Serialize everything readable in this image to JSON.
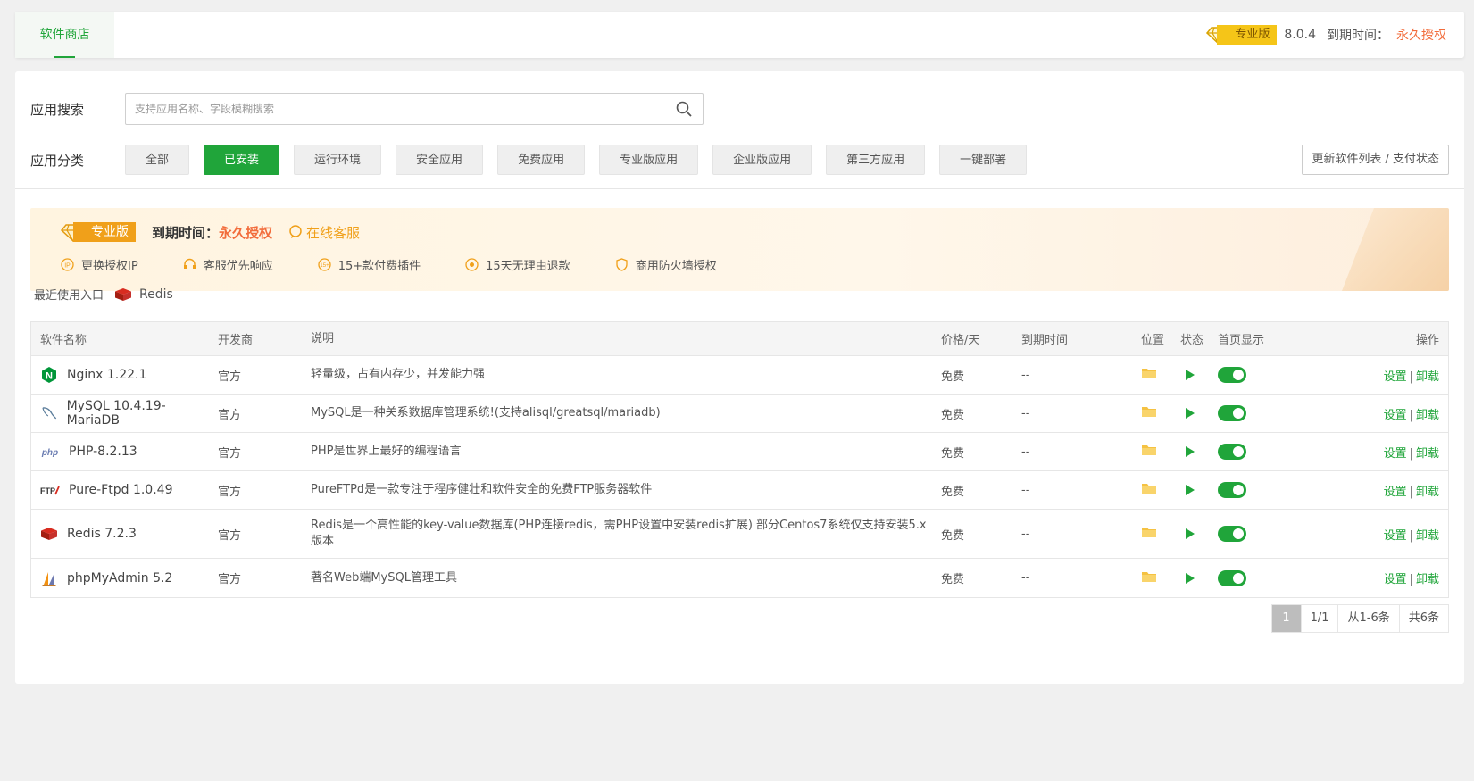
{
  "header": {
    "tab_store": "软件商店",
    "pro_label": "专业版",
    "version": "8.0.4",
    "expire_label": "到期时间：",
    "expire_value": "永久授权"
  },
  "search": {
    "label": "应用搜索",
    "placeholder": "支持应用名称、字段模糊搜索",
    "value": ""
  },
  "category": {
    "label": "应用分类",
    "items": [
      "全部",
      "已安装",
      "运行环境",
      "安全应用",
      "免费应用",
      "专业版应用",
      "企业版应用",
      "第三方应用",
      "一键部署"
    ],
    "active": "已安装",
    "refresh_label": "更新软件列表 / 支付状态"
  },
  "banner": {
    "pro_label": "专业版",
    "expire_label": "到期时间：",
    "expire_value": "永久授权",
    "service_label": "在线客服",
    "features": [
      "更换授权IP",
      "客服优先响应",
      "15+款付费插件",
      "15天无理由退款",
      "商用防火墙授权"
    ]
  },
  "recent": {
    "label": "最近使用入口",
    "items": [
      "Redis"
    ]
  },
  "table": {
    "headers": [
      "软件名称",
      "开发商",
      "说明",
      "价格/天",
      "到期时间",
      "位置",
      "状态",
      "首页显示",
      "操作"
    ],
    "rows": [
      {
        "name": "Nginx 1.22.1",
        "dev": "官方",
        "desc": "轻量级，占有内存少，并发能力强",
        "price": "免费",
        "expire": "--",
        "icon": "nginx-icon"
      },
      {
        "name": "MySQL 10.4.19-MariaDB",
        "dev": "官方",
        "desc": "MySQL是一种关系数据库管理系统!(支持alisql/greatsql/mariadb)",
        "price": "免费",
        "expire": "--",
        "icon": "mysql-icon"
      },
      {
        "name": "PHP-8.2.13",
        "dev": "官方",
        "desc": "PHP是世界上最好的编程语言",
        "price": "免费",
        "expire": "--",
        "icon": "php-icon"
      },
      {
        "name": "Pure-Ftpd 1.0.49",
        "dev": "官方",
        "desc": "PureFTPd是一款专注于程序健壮和软件安全的免费FTP服务器软件",
        "price": "免费",
        "expire": "--",
        "icon": "ftp-icon"
      },
      {
        "name": "Redis 7.2.3",
        "dev": "官方",
        "desc": "Redis是一个高性能的key-value数据库(PHP连接redis，需PHP设置中安装redis扩展) 部分Centos7系统仅支持安装5.x版本",
        "price": "免费",
        "expire": "--",
        "icon": "redis-icon"
      },
      {
        "name": "phpMyAdmin 5.2",
        "dev": "官方",
        "desc": "著名Web端MySQL管理工具",
        "price": "免费",
        "expire": "--",
        "icon": "phpmyadmin-icon"
      }
    ],
    "op_settings": "设置",
    "op_sep": "|",
    "op_uninstall": "卸载"
  },
  "pager": {
    "current": "1",
    "pages": "1/1",
    "range": "从1-6条",
    "total": "共6条"
  },
  "colors": {
    "accent": "#20a53a",
    "perm": "#f26c3b",
    "pro": "#f5c518"
  }
}
